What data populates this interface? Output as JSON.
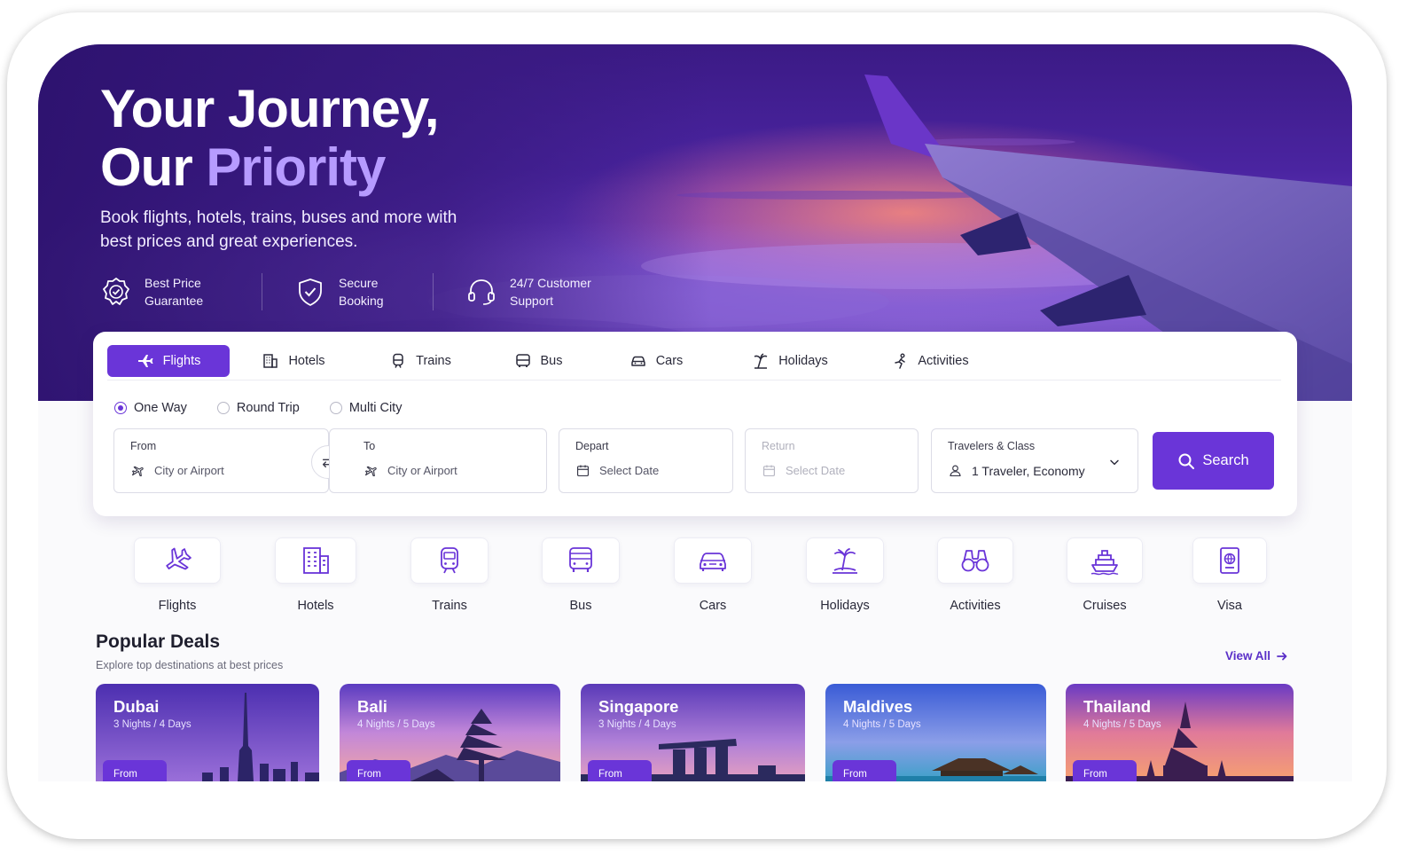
{
  "hero": {
    "headline_line1": "Your Journey,",
    "headline_line2_prefix": "Our ",
    "headline_line2_accent": "Priority",
    "subtitle": "Book flights, hotels, trains, buses and more with best prices and great experiences.",
    "features": [
      {
        "icon": "badge-check-icon",
        "label": "Best Price Guarantee"
      },
      {
        "icon": "shield-check-icon",
        "label": "Secure Booking"
      },
      {
        "icon": "headset-icon",
        "label": "24/7 Customer Support"
      }
    ]
  },
  "search": {
    "tabs": [
      {
        "label": "Flights",
        "icon": "plane-icon",
        "active": true
      },
      {
        "label": "Hotels",
        "icon": "building-icon",
        "active": false
      },
      {
        "label": "Trains",
        "icon": "train-icon",
        "active": false
      },
      {
        "label": "Bus",
        "icon": "bus-icon",
        "active": false
      },
      {
        "label": "Cars",
        "icon": "car-icon",
        "active": false
      },
      {
        "label": "Holidays",
        "icon": "beach-icon",
        "active": false
      },
      {
        "label": "Activities",
        "icon": "activity-icon",
        "active": false
      }
    ],
    "trip_types": [
      {
        "label": "One Way",
        "checked": true
      },
      {
        "label": "Round Trip",
        "checked": false
      },
      {
        "label": "Multi City",
        "checked": false
      }
    ],
    "from": {
      "label": "From",
      "placeholder": "City or Airport"
    },
    "to": {
      "label": "To",
      "placeholder": "City or Airport"
    },
    "depart": {
      "label": "Depart",
      "placeholder": "Select Date"
    },
    "return": {
      "label": "Return",
      "placeholder": "Select Date"
    },
    "travelers": {
      "label": "Travelers & Class",
      "value": "1 Traveler, Economy"
    },
    "button": "Search"
  },
  "categories": [
    "Flights",
    "Hotels",
    "Trains",
    "Bus",
    "Cars",
    "Holidays",
    "Activities",
    "Cruises",
    "Visa"
  ],
  "deals": {
    "title": "Popular Deals",
    "subtitle": "Explore top destinations at best prices",
    "view_all": "View All",
    "items": [
      {
        "name": "Dubai",
        "nights": "3 Nights / 4 Days",
        "from": "From"
      },
      {
        "name": "Bali",
        "nights": "4 Nights / 5 Days",
        "from": "From"
      },
      {
        "name": "Singapore",
        "nights": "3 Nights / 4 Days",
        "from": "From"
      },
      {
        "name": "Maldives",
        "nights": "4 Nights / 5 Days",
        "from": "From"
      },
      {
        "name": "Thailand",
        "nights": "4 Nights / 5 Days",
        "from": "From"
      }
    ]
  },
  "colors": {
    "accent": "#6a35d8",
    "accent_light": "#b69bff",
    "hero_dark": "#3b1a85"
  }
}
